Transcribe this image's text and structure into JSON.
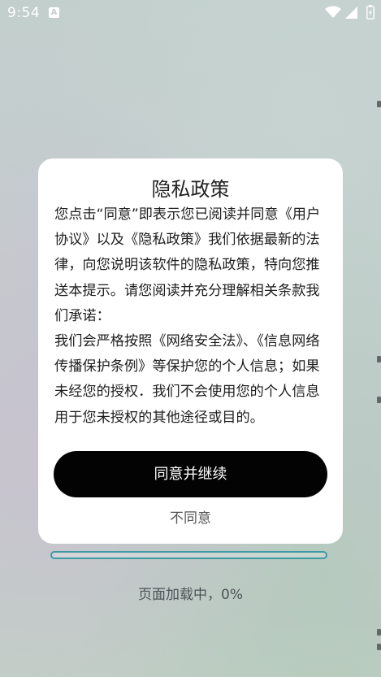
{
  "status_bar": {
    "time": "9:54",
    "notification_icon": "a-icon"
  },
  "dialog": {
    "title": "隐私政策",
    "paragraphs": [
      "您点击“同意”即表示您已阅读并同意《用户协议》以及《隐私政策》我们依据最新的法律，向您说明该软件的隐私政策，特向您推送本提示。请您阅读并充分理解相关条款我们承诺：",
      "我们会严格按照《网络安全法》、《信息网络传播保护条例》等保护您的个人信息；如果未经您的授权．我们不会使用您的个人信息用于您未授权的其他途径或目的。"
    ],
    "agree_label": "同意并继续",
    "disagree_label": "不同意"
  },
  "loading": {
    "progress_percent": 0,
    "text": "页面加载中，0%"
  },
  "colors": {
    "accent": "#3e9aa3",
    "button_bg": "#030303"
  }
}
